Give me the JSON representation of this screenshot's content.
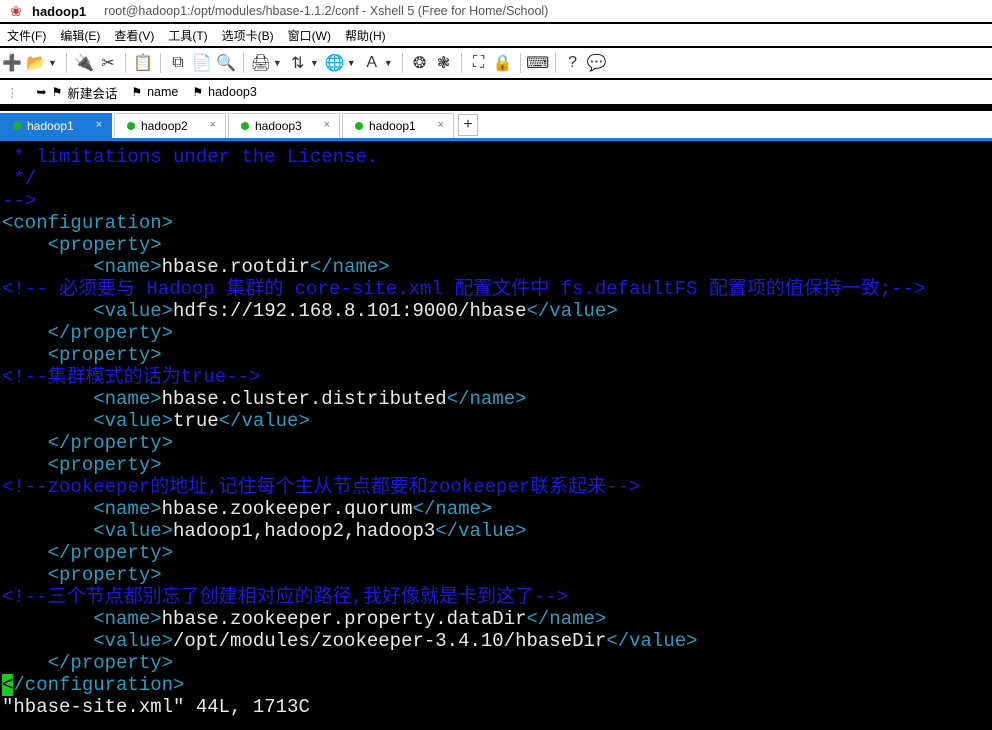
{
  "window": {
    "app_name": "hadoop1",
    "title_path": "root@hadoop1:/opt/modules/hbase-1.1.2/conf - Xshell 5 (Free for Home/School)"
  },
  "menu": [
    "文件(F)",
    "编辑(E)",
    "查看(V)",
    "工具(T)",
    "选项卡(B)",
    "窗口(W)",
    "帮助(H)"
  ],
  "linkbar": {
    "new_session": "新建会话",
    "link_name": "name",
    "link_hadoop3": "hadoop3"
  },
  "tabs": [
    {
      "label": "hadoop1",
      "active": true
    },
    {
      "label": "hadoop2",
      "active": false
    },
    {
      "label": "hadoop3",
      "active": false
    },
    {
      "label": "hadoop1",
      "active": false
    }
  ],
  "tab_close_glyph": "×",
  "tab_add_glyph": "+",
  "colors": {
    "active_tab": "#1e7ad8",
    "connected_dot": "#1bb523",
    "comment": "#1b1bd6",
    "xml_tag": "#2f9bc0",
    "terminal_text": "#e8e8e8",
    "cursor": "#20c820"
  },
  "terminal": {
    "lines": [
      " * limitations under the License.",
      " */",
      "-->",
      "<configuration>",
      "    <property>",
      "        <name>",
      "hbase.rootdir",
      "</name>",
      "<!-- 必须要与 Hadoop 集群的 core-site.xml 配置文件中 fs.defaultFS 配置项的值保持一致;-->",
      "        <value>",
      "hdfs://192.168.8.101:9000/hbase",
      "</value>",
      "    </property>",
      "    <property>",
      "<!--集群模式的话为true-->",
      "        <name>",
      "hbase.cluster.distributed",
      "</name>",
      "        <value>",
      "true",
      "</value>",
      "    </property>",
      "    <property>",
      "<!--zookeeper的地址,记住每个主从节点都要和zookeeper联系起来-->",
      "        <name>",
      "hbase.zookeeper.quorum",
      "</name>",
      "        <value>",
      "hadoop1,hadoop2,hadoop3",
      "</value>",
      "    </property>",
      "    <property>",
      "<!--三个节点都别忘了创建相对应的路径,我好像就是卡到这了-->",
      "        <name>",
      "hbase.zookeeper.property.dataDir",
      "</name>",
      "        <value>",
      "/opt/modules/zookeeper-3.4.10/hbaseDir",
      "</value>",
      "    </property>",
      "<",
      "/configuration>"
    ],
    "status_line": "\"hbase-site.xml\" 44L, 1713C"
  }
}
